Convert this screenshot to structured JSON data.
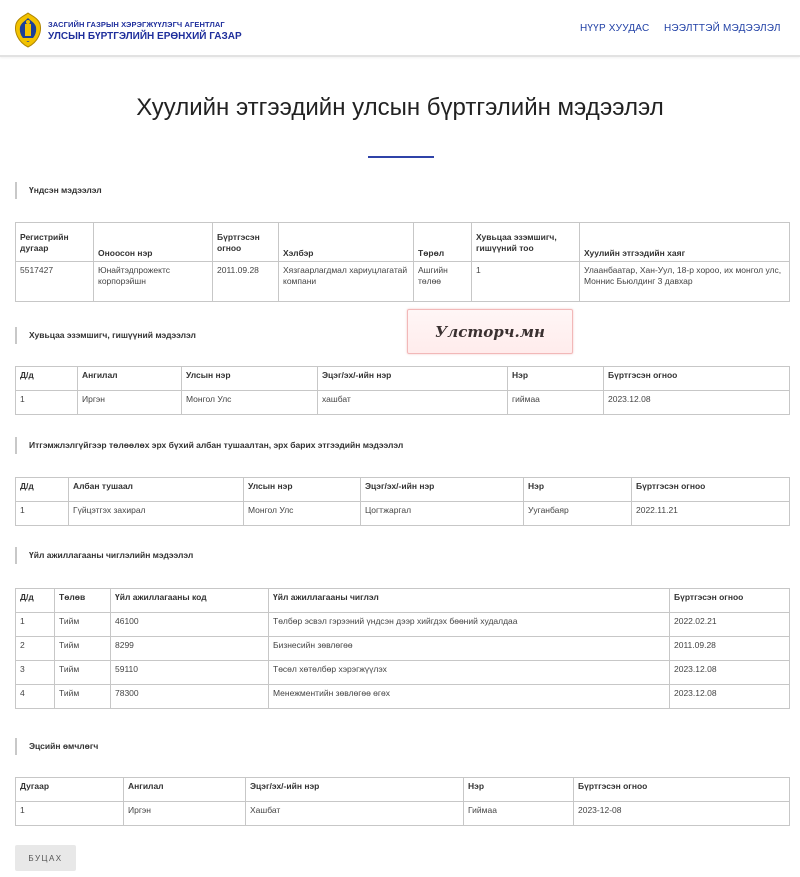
{
  "header": {
    "agency_line1": "ЗАСГИЙН ГАЗРЫН ХЭРЭГЖҮҮЛЭГЧ АГЕНТЛАГ",
    "agency_line2": "УЛСЫН БҮРТГЭЛИЙН ЕРӨНХИЙ ГАЗАР",
    "nav": {
      "home": "НҮҮР ХУУДАС",
      "public_info": "НЭЭЛТТЭЙ МЭДЭЭЛЭЛ"
    },
    "logo_icon": "soyombo-emblem-icon"
  },
  "page_title": "Хуулийн этгээдийн улсын бүртгэлийн мэдээлэл",
  "watermark": "Улсторч.мн",
  "colors": {
    "brand": "#1f2f9c",
    "accent": "#2f43a8"
  },
  "basic": {
    "heading": "Үндсэн мэдээлэл",
    "headers": [
      "Регистрийн дугаар",
      "Оноосон нэр",
      "Бүртгэсэн огноо",
      "Хэлбэр",
      "Төрөл",
      "Хувьцаа эзэмшигч, гишүүний тоо",
      "Хуулийн этгээдийн хаяг"
    ],
    "rows": [
      [
        "5517427",
        "Юнайтэдпрожектс корпорэйшн",
        "2011.09.28",
        "Хязгаарлагдмал хариуцлагатай компани",
        "Ашгийн төлөө",
        "1",
        "Улаанбаатар, Хан-Уул, 18-р хороо, их монгол улс, Моннис Бьюлдинг 3 давхар"
      ]
    ]
  },
  "shareholders": {
    "heading": "Хувьцаа эзэмшигч, гишүүний мэдээлэл",
    "headers": [
      "Д/д",
      "Ангилал",
      "Улсын нэр",
      "Эцэг/эх/-ийн нэр",
      "Нэр",
      "Бүртгэсэн огноо"
    ],
    "rows": [
      [
        "1",
        "Иргэн",
        "Монгол Улс",
        "хашбат",
        "гиймаа",
        "2023.12.08"
      ]
    ]
  },
  "officials": {
    "heading": "Итгэмжлэлгүйгээр төлөөлөх эрх бүхий албан тушаалтан, эрх барих этгээдийн мэдээлэл",
    "headers": [
      "Д/д",
      "Албан тушаал",
      "Улсын нэр",
      "Эцэг/эх/-ийн нэр",
      "Нэр",
      "Бүртгэсэн огноо"
    ],
    "rows": [
      [
        "1",
        "Гүйцэтгэх захирал",
        "Монгол Улс",
        "Цогтжаргал",
        "Ууганбаяр",
        "2022.11.21"
      ]
    ]
  },
  "activities": {
    "heading": "Үйл ажиллагааны чиглэлийн мэдээлэл",
    "headers": [
      "Д/д",
      "Төлөв",
      "Үйл ажиллагааны код",
      "Үйл ажиллагааны чиглэл",
      "Бүртгэсэн огноо"
    ],
    "rows": [
      [
        "1",
        "Тийм",
        "46100",
        "Төлбөр эсвэл гэрээний үндсэн дээр хийгдэх бөөний худалдаа",
        "2022.02.21"
      ],
      [
        "2",
        "Тийм",
        "8299",
        "Бизнесийн зөвлөгөө",
        "2011.09.28"
      ],
      [
        "3",
        "Тийм",
        "59110",
        "Төсөл хөтөлбөр хэрэгжүүлэх",
        "2023.12.08"
      ],
      [
        "4",
        "Тийм",
        "78300",
        "Менежментийн зөвлөгөө өгөх",
        "2023.12.08"
      ]
    ]
  },
  "beneficiary": {
    "heading": "Эцсийн өмчлөгч",
    "headers": [
      "Дугаар",
      "Ангилал",
      "Эцэг/эх/-ийн нэр",
      "Нэр",
      "Бүртгэсэн огноо"
    ],
    "rows": [
      [
        "1",
        "Иргэн",
        "Хашбат",
        "Гиймаа",
        "2023-12-08"
      ]
    ]
  },
  "back_button": "БУЦАХ"
}
